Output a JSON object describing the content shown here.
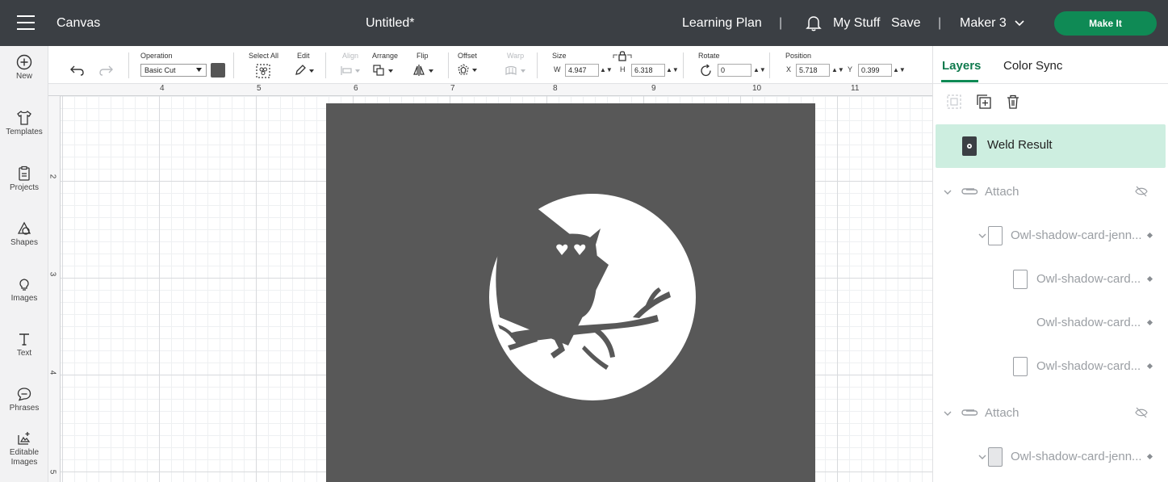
{
  "topbar": {
    "title": "Canvas",
    "document": "Untitled*",
    "learning_plan": "Learning Plan",
    "separator": "|",
    "my_stuff": "My Stuff",
    "save": "Save",
    "machine": "Maker 3",
    "make_it": "Make It"
  },
  "rail": [
    {
      "label": "New",
      "icon": "plus-circle-icon"
    },
    {
      "label": "Templates",
      "icon": "tshirt-icon"
    },
    {
      "label": "Projects",
      "icon": "clipboard-icon"
    },
    {
      "label": "Shapes",
      "icon": "shapes-icon"
    },
    {
      "label": "Images",
      "icon": "lightbulb-icon"
    },
    {
      "label": "Text",
      "icon": "text-icon"
    },
    {
      "label": "Phrases",
      "icon": "speech-bubble-icon"
    },
    {
      "label": "Editable Images",
      "icon": "editable-images-icon"
    }
  ],
  "toolbar": {
    "operation_label": "Operation",
    "operation_value": "Basic Cut",
    "select_all": "Select All",
    "edit": "Edit",
    "align": "Align",
    "arrange": "Arrange",
    "flip": "Flip",
    "offset": "Offset",
    "warp": "Warp",
    "size": "Size",
    "w_label": "W",
    "w_value": "4.947",
    "h_label": "H",
    "h_value": "6.318",
    "rotate": "Rotate",
    "rotate_value": "0",
    "position": "Position",
    "x_label": "X",
    "x_value": "5.718",
    "y_label": "Y",
    "y_value": "0.399",
    "swatch_color": "#555555"
  },
  "ruler": {
    "top": [
      "4",
      "5",
      "6",
      "7",
      "8",
      "9",
      "10",
      "11"
    ],
    "left": [
      "2",
      "3",
      "4",
      "5"
    ]
  },
  "panel": {
    "tabs": [
      "Layers",
      "Color Sync"
    ],
    "layers": [
      {
        "label": "Weld Result",
        "selected": true
      },
      {
        "label": "Attach"
      },
      {
        "label": "Owl-shadow-card-jenn..."
      },
      {
        "label": "Owl-shadow-card..."
      },
      {
        "label": "Owl-shadow-card..."
      },
      {
        "label": "Owl-shadow-card..."
      },
      {
        "label": "Attach"
      },
      {
        "label": "Owl-shadow-card-jenn..."
      }
    ]
  }
}
